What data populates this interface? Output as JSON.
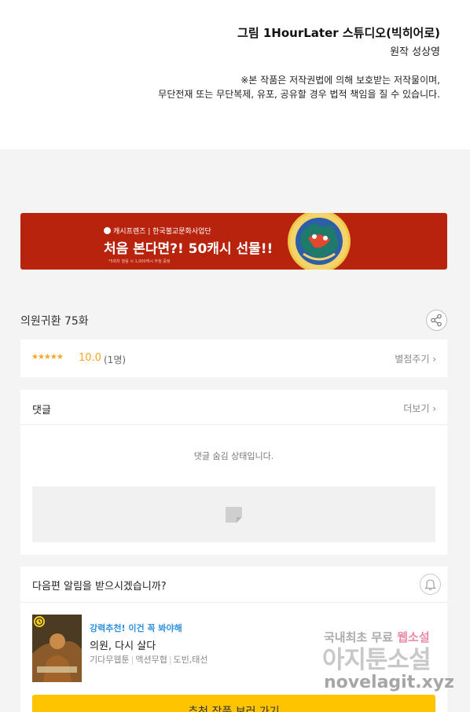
{
  "credits": {
    "art_line": "그림  1HourLater 스튜디오(빅히어로)",
    "original_line": "원작 성상영",
    "copyright_line1": "※본 작품은 저작권법에 의해 보호받는 저작물이며,",
    "copyright_line2": "무단전재 또는 무단복제, 유포, 공유할 경우 법적 책임을 질 수 있습니다."
  },
  "banner": {
    "brand_text": "캐시프렌즈 | 한국불교문화사업단",
    "headline": "처음 본다면?! 50캐시 선물!!",
    "fine_print": "*5회차 열람 시 1,000캐시 추첨 증정"
  },
  "episode": {
    "title": "의원귀환 75화",
    "share_icon": "share-icon"
  },
  "rating": {
    "stars": "★★★★★",
    "score": "10.0",
    "count": "(1명)",
    "rate_label": "별점주기 ›"
  },
  "comments": {
    "title": "댓글",
    "more_label": "더보기 ›",
    "hidden_message": "댓글 숨김 상태입니다."
  },
  "notification": {
    "question": "다음편 알림을 받으시겠습니까?",
    "bell_icon": "bell-icon"
  },
  "recommendation": {
    "tag": "강력추천! 이건 꼭 봐야해",
    "work_title": "의원, 다시 살다",
    "meta": [
      "기다무웹툰",
      "액션무협",
      "도빈,태선"
    ],
    "cta_label": "추천 작품 보러 가기"
  },
  "watermark": {
    "line1_prefix": "국내최초 무료 ",
    "line1_highlight": "웹소설",
    "line2": "아지툰소설",
    "line3": "novelagit.xyz"
  },
  "colors": {
    "accent_yellow": "#ffc400",
    "star_orange": "#f5a623",
    "banner_red": "#b8230e",
    "tag_blue": "#2f8fdc"
  }
}
